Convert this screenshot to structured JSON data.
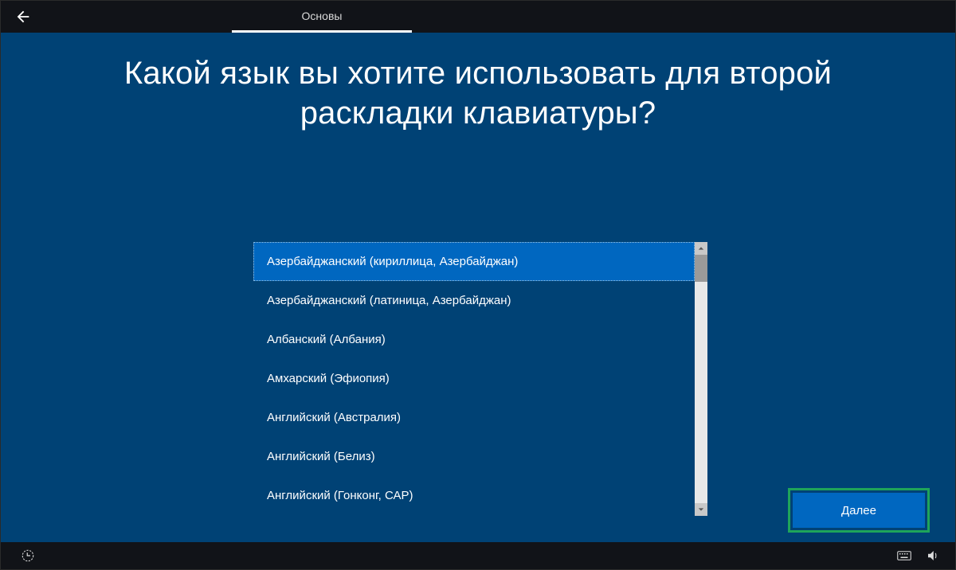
{
  "header": {
    "tab_label": "Основы"
  },
  "main": {
    "heading_line1": "Какой язык вы хотите использовать для второй",
    "heading_line2": "раскладки клавиатуры?"
  },
  "list": {
    "items": [
      {
        "label": "Азербайджанский (кириллица, Азербайджан)",
        "selected": true
      },
      {
        "label": "Азербайджанский (латиница, Азербайджан)",
        "selected": false
      },
      {
        "label": "Албанский (Албания)",
        "selected": false
      },
      {
        "label": "Амхарский (Эфиопия)",
        "selected": false
      },
      {
        "label": "Английский (Австралия)",
        "selected": false
      },
      {
        "label": "Английский (Белиз)",
        "selected": false
      },
      {
        "label": "Английский (Гонконг, САР)",
        "selected": false
      }
    ]
  },
  "footer": {
    "next_label": "Далее"
  },
  "icons": {
    "back": "back-arrow-icon",
    "ease_of_access": "ease-of-access-icon",
    "keyboard": "keyboard-icon",
    "volume": "volume-icon"
  },
  "colors": {
    "page_bg": "#004275",
    "accent": "#0067c0",
    "highlight_border": "#1fa45a"
  }
}
